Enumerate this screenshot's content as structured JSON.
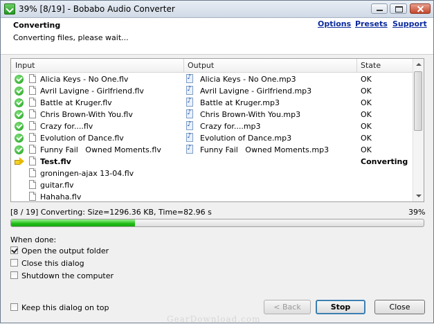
{
  "window": {
    "title": "39% [8/19] - Bobabo Audio Converter"
  },
  "header": {
    "heading": "Converting",
    "subheading": "Converting files, please wait...",
    "links": {
      "options": "Options",
      "presets": "Presets",
      "support": "Support"
    }
  },
  "list": {
    "columns": {
      "input": "Input",
      "output": "Output",
      "state": "State"
    },
    "rows": [
      {
        "status": "ok-icon",
        "input": "Alicia Keys - No One.flv",
        "output": "Alicia Keys - No One.mp3",
        "state": "OK"
      },
      {
        "status": "ok-icon",
        "input": "Avril Lavigne - Girlfriend.flv",
        "output": "Avril Lavigne - Girlfriend.mp3",
        "state": "OK"
      },
      {
        "status": "ok-icon",
        "input": "Battle at Kruger.flv",
        "output": "Battle at Kruger.mp3",
        "state": "OK"
      },
      {
        "status": "ok-icon",
        "input": "Chris Brown-With You.flv",
        "output": "Chris Brown-With You.mp3",
        "state": "OK"
      },
      {
        "status": "ok-icon",
        "input": "Crazy for....flv",
        "output": "Crazy for....mp3",
        "state": "OK"
      },
      {
        "status": "ok-icon",
        "input": "Evolution of Dance.flv",
        "output": "Evolution of Dance.mp3",
        "state": "OK"
      },
      {
        "status": "ok-icon",
        "input": "Funny Fail   Owned Moments.flv",
        "output": "Funny Fail   Owned Moments.mp3",
        "state": "OK"
      },
      {
        "status": "arrow-icon",
        "input": "Test.flv",
        "output": "",
        "state": "Converting"
      },
      {
        "status": "",
        "input": "groningen-ajax 13-04.flv",
        "output": "",
        "state": ""
      },
      {
        "status": "",
        "input": "guitar.flv",
        "output": "",
        "state": ""
      },
      {
        "status": "",
        "input": "Hahaha.flv",
        "output": "",
        "state": ""
      }
    ]
  },
  "progress": {
    "info": "[8 / 19] Converting: Size=1296.36 KB, Time=82.96 s",
    "percent_text": "39%",
    "fraction": 0.3
  },
  "when_done": {
    "label": "When done:",
    "open_folder": "Open the output folder",
    "close_dialog": "Close this dialog",
    "shutdown": "Shutdown the computer"
  },
  "footer": {
    "keep_on_top": "Keep this dialog on top",
    "back": "< Back",
    "stop": "Stop",
    "close": "Close"
  },
  "watermark": "GearDownload.com",
  "colors": {
    "progress": "#1fbd17",
    "link": "#0a2a9c",
    "ok": "#1c9d19"
  }
}
